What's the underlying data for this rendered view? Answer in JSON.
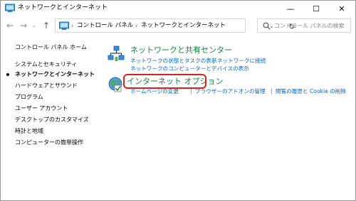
{
  "window": {
    "title": "ネットワークとインターネット",
    "controls": {
      "minimize": "—",
      "maximize": "☐",
      "close": "✕"
    }
  },
  "nav": {
    "back": "←",
    "forward": "→",
    "recent": "⌄",
    "up": "↑",
    "breadcrumbs": [
      "コントロール パネル",
      "ネットワークとインターネット"
    ],
    "separator": "›",
    "dropdown": "⌄",
    "refresh": "↻"
  },
  "search": {
    "placeholder": "コントロール パネルの検索"
  },
  "sidebar": {
    "home": "コントロール パネル ホーム",
    "items": [
      {
        "label": "システムとセキュリティ",
        "current": false
      },
      {
        "label": "ネットワークとインターネット",
        "current": true
      },
      {
        "label": "ハードウェアとサウンド",
        "current": false
      },
      {
        "label": "プログラム",
        "current": false
      },
      {
        "label": "ユーザー アカウント",
        "current": false
      },
      {
        "label": "デスクトップのカスタマイズ",
        "current": false
      },
      {
        "label": "時計と地域",
        "current": false
      },
      {
        "label": "コンピューターの簡単操作",
        "current": false
      }
    ]
  },
  "categories": [
    {
      "title": "ネットワークと共有センター",
      "icon": "network-center-icon",
      "links": [
        "ネットワークの状態とタスクの表示",
        "ネットワークに接続",
        "ネットワークのコンピューターとデバイスの表示"
      ]
    },
    {
      "title": "インターネット オプション",
      "icon": "internet-options-icon",
      "links": [
        "ホームページの変更",
        "ブラウザーのアドオンの管理",
        "閲覧の履歴と Cookie の削除"
      ]
    }
  ],
  "colors": {
    "category_title": "#0d8a3a",
    "link": "#0066cc",
    "highlight": "#d92020"
  }
}
